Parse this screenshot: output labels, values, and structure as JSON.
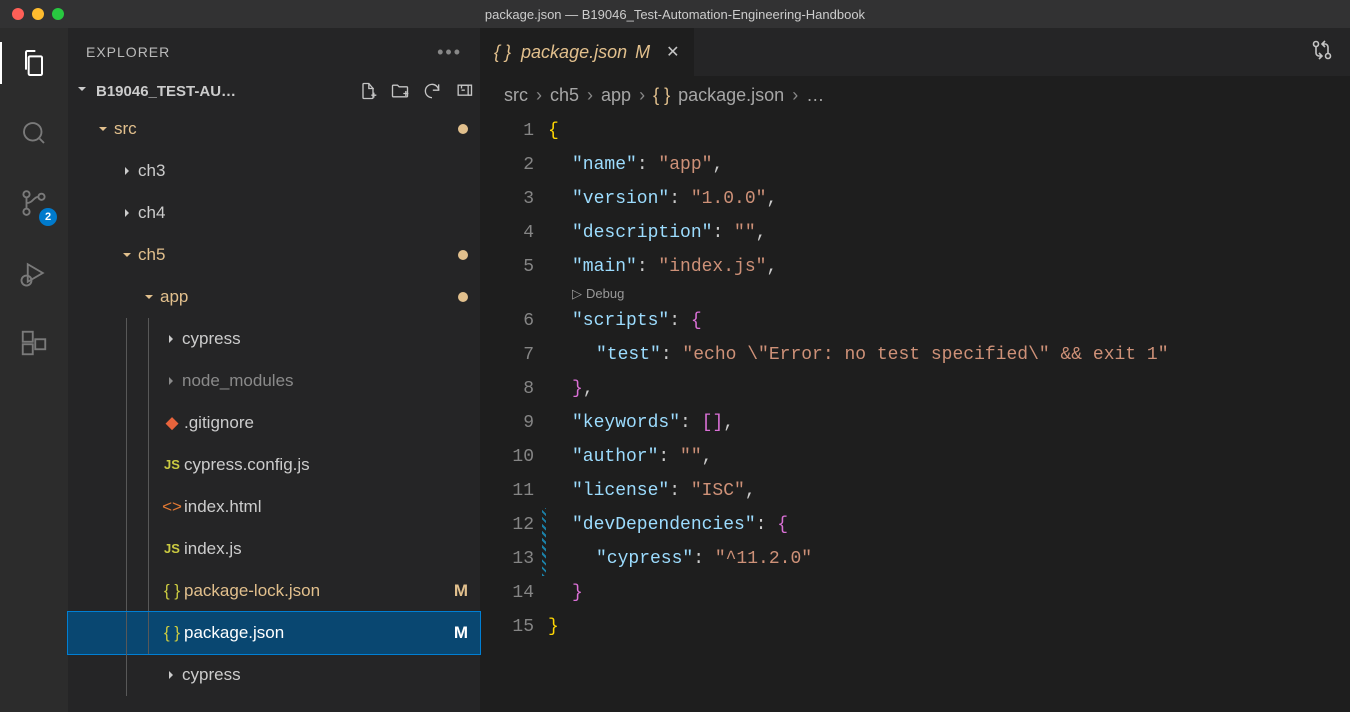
{
  "window": {
    "title": "package.json — B19046_Test-Automation-Engineering-Handbook"
  },
  "activitybar": {
    "scm_badge": "2"
  },
  "sidebar": {
    "title": "EXPLORER",
    "project_name": "B19046_TEST-AU…",
    "tree": {
      "src": "src",
      "ch3": "ch3",
      "ch4": "ch4",
      "ch5": "ch5",
      "app": "app",
      "cypress": "cypress",
      "node_modules": "node_modules",
      "gitignore": ".gitignore",
      "cypress_config": "cypress.config.js",
      "index_html": "index.html",
      "index_js": "index.js",
      "package_lock": "package-lock.json",
      "package": "package.json",
      "cypress2": "cypress",
      "package_lock_mod": "M",
      "package_mod": "M"
    }
  },
  "tab": {
    "label": "package.json",
    "mod": "M"
  },
  "breadcrumbs": {
    "a": "src",
    "b": "ch5",
    "c": "app",
    "d": "package.json",
    "e": "…"
  },
  "editor": {
    "codelens": "Debug",
    "lines": [
      "1",
      "2",
      "3",
      "4",
      "5",
      "6",
      "7",
      "8",
      "9",
      "10",
      "11",
      "12",
      "13",
      "14",
      "15"
    ],
    "content": {
      "name_key": "\"name\"",
      "name_val": "\"app\"",
      "version_key": "\"version\"",
      "version_val": "\"1.0.0\"",
      "desc_key": "\"description\"",
      "desc_val": "\"\"",
      "main_key": "\"main\"",
      "main_val": "\"index.js\"",
      "scripts_key": "\"scripts\"",
      "test_key": "\"test\"",
      "test_val": "\"echo \\\"Error: no test specified\\\" && exit 1\"",
      "keywords_key": "\"keywords\"",
      "author_key": "\"author\"",
      "author_val": "\"\"",
      "license_key": "\"license\"",
      "license_val": "\"ISC\"",
      "devdep_key": "\"devDependencies\"",
      "cypress_key": "\"cypress\"",
      "cypress_val": "\"^11.2.0\""
    }
  }
}
